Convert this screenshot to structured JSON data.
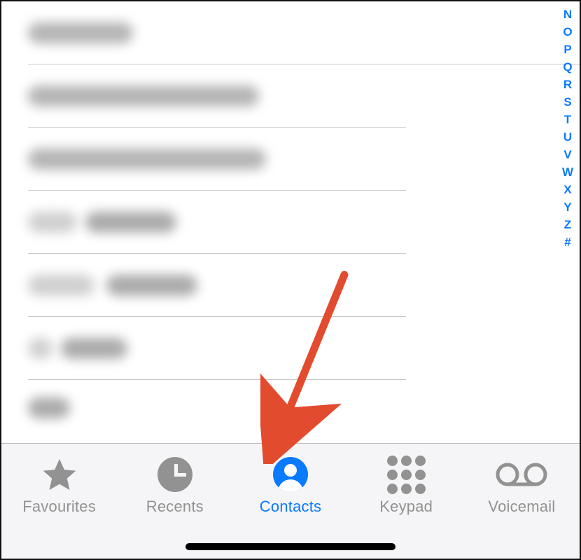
{
  "index_letters": [
    "N",
    "O",
    "P",
    "Q",
    "R",
    "S",
    "T",
    "U",
    "V",
    "W",
    "X",
    "Y",
    "Z",
    "#"
  ],
  "tabs": {
    "favourites": {
      "label": "Favourites",
      "active": false
    },
    "recents": {
      "label": "Recents",
      "active": false
    },
    "contacts": {
      "label": "Contacts",
      "active": true
    },
    "keypad": {
      "label": "Keypad",
      "active": false
    },
    "voicemail": {
      "label": "Voicemail",
      "active": false
    }
  },
  "contact_rows": [
    {
      "blurred": true
    },
    {
      "blurred": true
    },
    {
      "blurred": true
    },
    {
      "blurred": true
    },
    {
      "blurred": true
    },
    {
      "blurred": true
    },
    {
      "blurred": true
    }
  ],
  "colors": {
    "accent": "#0a7aff",
    "inactive": "#929292",
    "tabbar_bg": "#f5f5f7",
    "separator": "#c9c9c9"
  },
  "annotation": {
    "type": "arrow",
    "points_to": "contacts-tab",
    "color": "#e34b2e"
  }
}
